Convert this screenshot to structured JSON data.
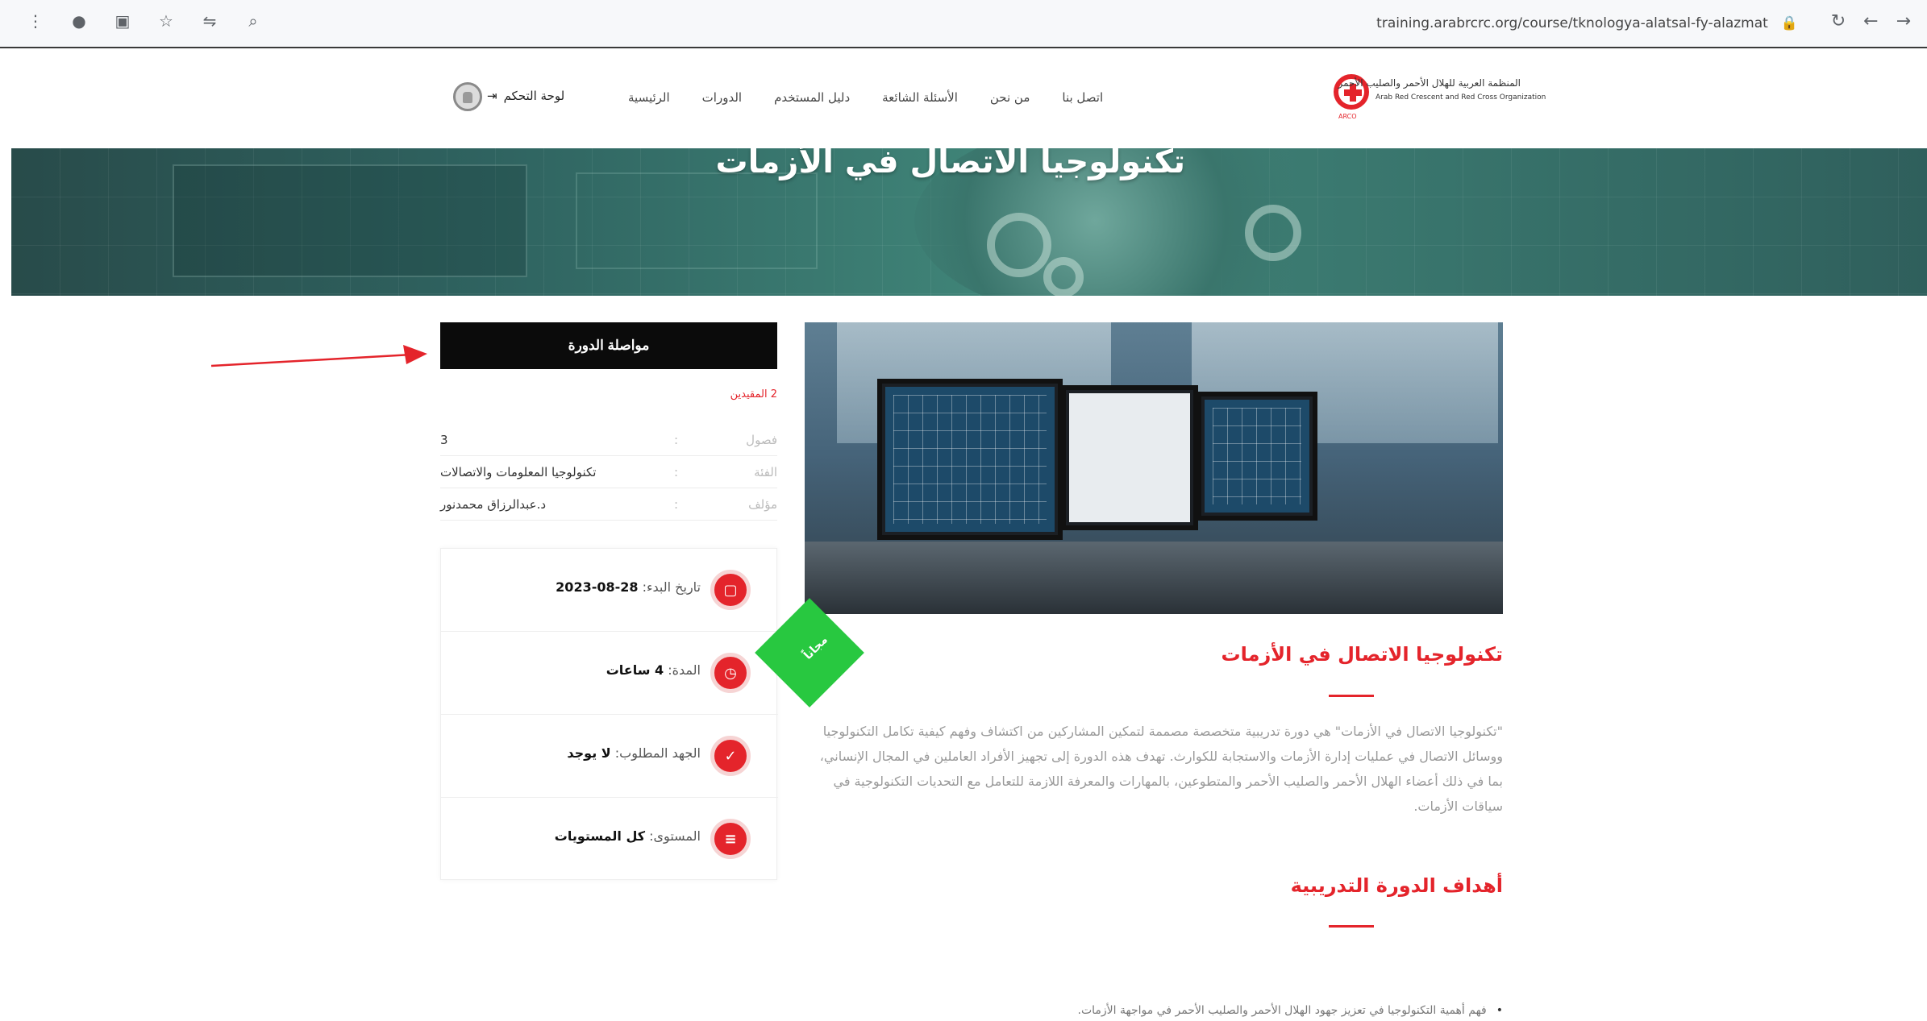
{
  "browser": {
    "url": "training.arabrcrc.org/course/tknologya-alatsal-fy-alazmat"
  },
  "site": {
    "logo_ar": "المنظمة العربية للهلال الأحمر والصليب الأحمر",
    "logo_en": "Arab Red Crescent and Red Cross Organization",
    "logo_abbr": "ARCO"
  },
  "nav": {
    "items": [
      "الرئيسية",
      "الدورات",
      "دليل المستخدم",
      "الأسئلة الشائعة",
      "من نحن",
      "اتصل بنا"
    ],
    "dashboard": "لوحة التحكم"
  },
  "hero": {
    "title": "تكنولوجيا الاتصال في الأزمات"
  },
  "sidebar": {
    "continue_label": "مواصلة الدورة",
    "enrolled": "2 المقيدين",
    "info": [
      {
        "label": "فصول",
        "value": "3"
      },
      {
        "label": "الفئة",
        "value": "تكنولوجيا المعلومات والاتصالات"
      },
      {
        "label": "مؤلف",
        "value": "د.عبدالرزاق محمدنور"
      }
    ],
    "meta": [
      {
        "key": "تاريخ البدء:",
        "value": "28-08-2023",
        "icon": "calendar-icon"
      },
      {
        "key": "المدة:",
        "value": "4 ساعات",
        "icon": "clock-icon"
      },
      {
        "key": "الجهد المطلوب:",
        "value": "لا يوجد",
        "icon": "check-icon"
      },
      {
        "key": "المستوى:",
        "value": "كل المستويات",
        "icon": "list-icon"
      }
    ]
  },
  "main": {
    "badge": "مجاناً",
    "course_title": "تكنولوجيا الاتصال في الأزمات",
    "description": "\"تكنولوجيا الاتصال في الأزمات\" هي دورة تدريبية متخصصة مصممة لتمكين المشاركين من اكتشاف وفهم كيفية تكامل التكنولوجيا ووسائل الاتصال في عمليات إدارة الأزمات والاستجابة للكوارث. تهدف هذه الدورة إلى تجهيز الأفراد العاملين في المجال الإنساني، بما في ذلك أعضاء الهلال الأحمر والصليب الأحمر والمتطوعين، بالمهارات والمعرفة اللازمة للتعامل مع التحديات التكنولوجية في سياقات الأزمات.",
    "goals_title": "أهداف الدورة التدريبية",
    "goals": [
      "فهم أهمية التكنولوجيا في تعزيز جهود الهلال الأحمر والصليب الأحمر في مواجهة الأزمات."
    ]
  },
  "colors": {
    "accent": "#e4242b",
    "badge": "#28c840",
    "button": "#0b0b0b"
  }
}
